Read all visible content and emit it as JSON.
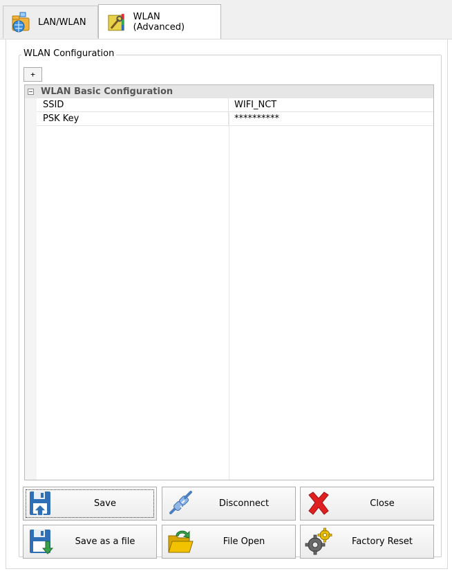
{
  "tabs": [
    {
      "label": "LAN/WLAN",
      "icon": "network-folder-icon",
      "active": false
    },
    {
      "label": "WLAN (Advanced)",
      "icon": "tools-icon",
      "active": true
    }
  ],
  "group": {
    "title": "WLAN Configuration",
    "expand_label": "+"
  },
  "grid": {
    "category": "WLAN Basic Configuration",
    "properties": [
      {
        "name": "SSID",
        "value": "WIFI_NCT"
      },
      {
        "name": "PSK Key",
        "value": "**********"
      }
    ]
  },
  "buttons": {
    "save": {
      "label": "Save",
      "icon": "floppy-disk-icon"
    },
    "disconnect": {
      "label": "Disconnect",
      "icon": "plug-disconnect-icon"
    },
    "close": {
      "label": "Close",
      "icon": "red-x-icon"
    },
    "save_as_file": {
      "label": "Save as a file",
      "icon": "floppy-download-icon"
    },
    "file_open": {
      "label": "File Open",
      "icon": "open-folder-icon"
    },
    "factory_reset": {
      "label": "Factory Reset",
      "icon": "gears-icon"
    }
  },
  "colors": {
    "close_red": "#e02020",
    "save_blue": "#2e6fb5",
    "save_green": "#3aa04a",
    "folder_yellow": "#f2c200"
  }
}
